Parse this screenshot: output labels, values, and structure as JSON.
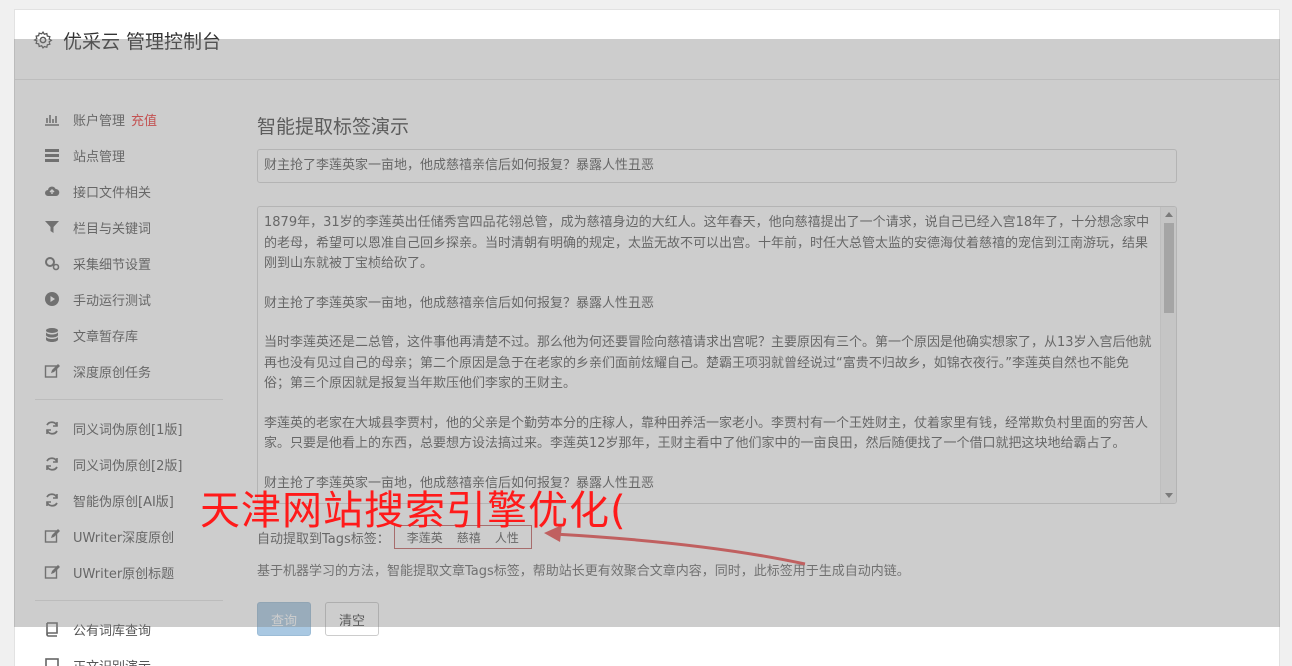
{
  "app": {
    "title": "优采云 管理控制台",
    "gear_icon": "gear-icon"
  },
  "sidebar": {
    "items": [
      {
        "label": "账户管理",
        "badge": "充值",
        "icon": "bar-chart-icon"
      },
      {
        "label": "站点管理",
        "icon": "server-icon"
      },
      {
        "label": "接口文件相关",
        "icon": "cloud-upload-icon"
      },
      {
        "label": "栏目与关键词",
        "icon": "filter-icon"
      },
      {
        "label": "采集细节设置",
        "icon": "gears-icon"
      },
      {
        "label": "手动运行测试",
        "icon": "play-circle-icon"
      },
      {
        "label": "文章暂存库",
        "icon": "database-icon"
      },
      {
        "label": "深度原创任务",
        "icon": "edit-icon"
      },
      {
        "label": "同义词伪原创[1版]",
        "icon": "refresh-icon"
      },
      {
        "label": "同义词伪原创[2版]",
        "icon": "refresh-icon"
      },
      {
        "label": "智能伪原创[AI版]",
        "icon": "refresh-icon"
      },
      {
        "label": "UWriter深度原创",
        "icon": "edit-icon"
      },
      {
        "label": "UWriter原创标题",
        "icon": "edit-icon"
      },
      {
        "label": "公有词库查询",
        "icon": "book-icon"
      },
      {
        "label": "正文识别演示",
        "icon": "square-icon"
      }
    ]
  },
  "main": {
    "page_title": "智能提取标签演示",
    "title_input_value": "财主抢了李莲英家一亩地，他成慈禧亲信后如何报复？暴露人性丑恶",
    "body_paragraphs": [
      "1879年，31岁的李莲英出任储秀宫四品花翎总管，成为慈禧身边的大红人。这年春天，他向慈禧提出了一个请求，说自己已经入宫18年了，十分想念家中的老母，希望可以恩准自己回乡探亲。当时清朝有明确的规定，太监无故不可以出宫。十年前，时任大总管太监的安德海仗着慈禧的宠信到江南游玩，结果刚到山东就被丁宝桢给砍了。",
      "财主抢了李莲英家一亩地，他成慈禧亲信后如何报复？暴露人性丑恶",
      "当时李莲英还是二总管，这件事他再清楚不过。那么他为何还要冒险向慈禧请求出宫呢？主要原因有三个。第一个原因是他确实想家了，从13岁入宫后他就再也没有见过自己的母亲；第二个原因是急于在老家的乡亲们面前炫耀自己。楚霸王项羽就曾经说过“富贵不归故乡，如锦衣夜行。”李莲英自然也不能免俗；第三个原因就是报复当年欺压他们李家的王财主。",
      "李莲英的老家在大城县李贾村，他的父亲是个勤劳本分的庄稼人，靠种田养活一家老小。李贾村有一个王姓财主，仗着家里有钱，经常欺负村里面的穷苦人家。只要是他看上的东西，总要想方设法搞过来。李莲英12岁那年，王财主看中了他们家中的一亩良田，然后随便找了一个借口就把这块地给霸占了。",
      "财主抢了李莲英家一亩地，他成慈禧亲信后如何报复？暴露人性丑恶"
    ],
    "tags_label": "自动提取到Tags标签：",
    "tags": [
      "李莲英",
      "慈禧",
      "人性"
    ],
    "description": "基于机器学习的方法，智能提取文章Tags标签，帮助站长更有效聚合文章内容，同时，此标签用于生成自动内链。",
    "query_button": "查询",
    "clear_button": "清空"
  },
  "watermark": {
    "text": "天津网站搜索引擎优化(",
    "color": "#ff1a1a"
  },
  "colors": {
    "overlay": "#828282",
    "accent": "#a9c8e2",
    "badge": "#e33333",
    "tag_border": "#c06060"
  }
}
